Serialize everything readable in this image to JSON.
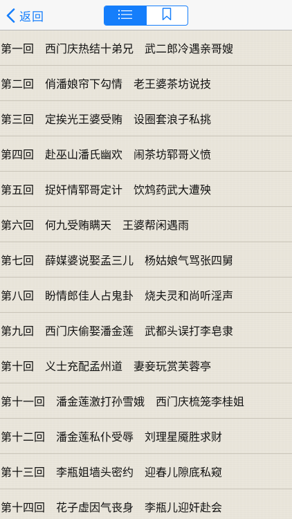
{
  "nav": {
    "back_label": "返回",
    "back_icon": "chevron-left-icon",
    "segments": [
      {
        "icon": "list-icon",
        "selected": true
      },
      {
        "icon": "bookmark-icon",
        "selected": false
      }
    ],
    "accent_color": "#157efb"
  },
  "chapters": [
    {
      "num": "第一回",
      "title": "西门庆热结十弟兄　武二郎冷遇亲哥嫂"
    },
    {
      "num": "第二回",
      "title": "俏潘娘帘下勾情　老王婆茶坊说技"
    },
    {
      "num": "第三回",
      "title": "定挨光王婆受贿　设圈套浪子私挑"
    },
    {
      "num": "第四回",
      "title": "赴巫山潘氏幽欢　闹茶坊郓哥义愤"
    },
    {
      "num": "第五回",
      "title": "捉奸情郓哥定计　饮鸩药武大遭殃"
    },
    {
      "num": "第六回",
      "title": "何九受贿瞒天　王婆帮闲遇雨"
    },
    {
      "num": "第七回",
      "title": "薛媒婆说娶孟三儿　杨姑娘气骂张四舅"
    },
    {
      "num": "第八回",
      "title": "盼情郎佳人占鬼卦　烧夫灵和尚听淫声"
    },
    {
      "num": "第九回",
      "title": "西门庆偷娶潘金莲　武都头误打李皂隶"
    },
    {
      "num": "第十回",
      "title": "义士充配孟州道　妻妾玩赏芙蓉亭"
    },
    {
      "num": "第十一回",
      "title": "潘金莲激打孙雪娥　西门庆梳笼李桂姐"
    },
    {
      "num": "第十二回",
      "title": "潘金莲私仆受辱　刘理星魇胜求财"
    },
    {
      "num": "第十三回",
      "title": "李瓶姐墙头密约　迎春儿隙底私窥"
    },
    {
      "num": "第十四回",
      "title": "花子虚因气丧身　李瓶儿迎奸赴会"
    }
  ]
}
